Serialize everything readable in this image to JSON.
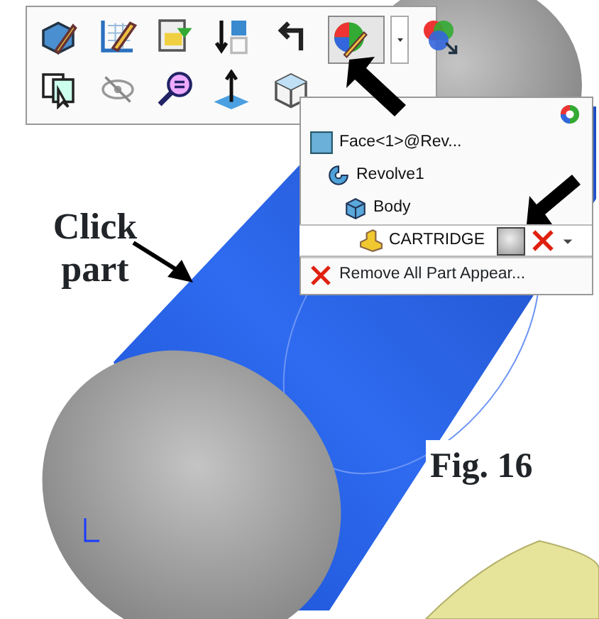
{
  "toolbar": {
    "appearance_button": {
      "pressed": true
    }
  },
  "appearance_menu": {
    "items": [
      {
        "kind": "face",
        "label": "Face<1>@Rev...",
        "selected": false,
        "children": [
          {
            "kind": "feature",
            "label": "Revolve1",
            "selected": false,
            "children": [
              {
                "kind": "body",
                "label": "Body",
                "selected": false,
                "children": [
                  {
                    "kind": "part",
                    "label": "CARTRIDGE",
                    "selected": true
                  }
                ]
              }
            ]
          }
        ]
      }
    ],
    "remove_item": {
      "label": "Remove All Part Appear..."
    }
  },
  "annotations": {
    "callout": "Click part",
    "figure_label": "Fig. 16"
  }
}
